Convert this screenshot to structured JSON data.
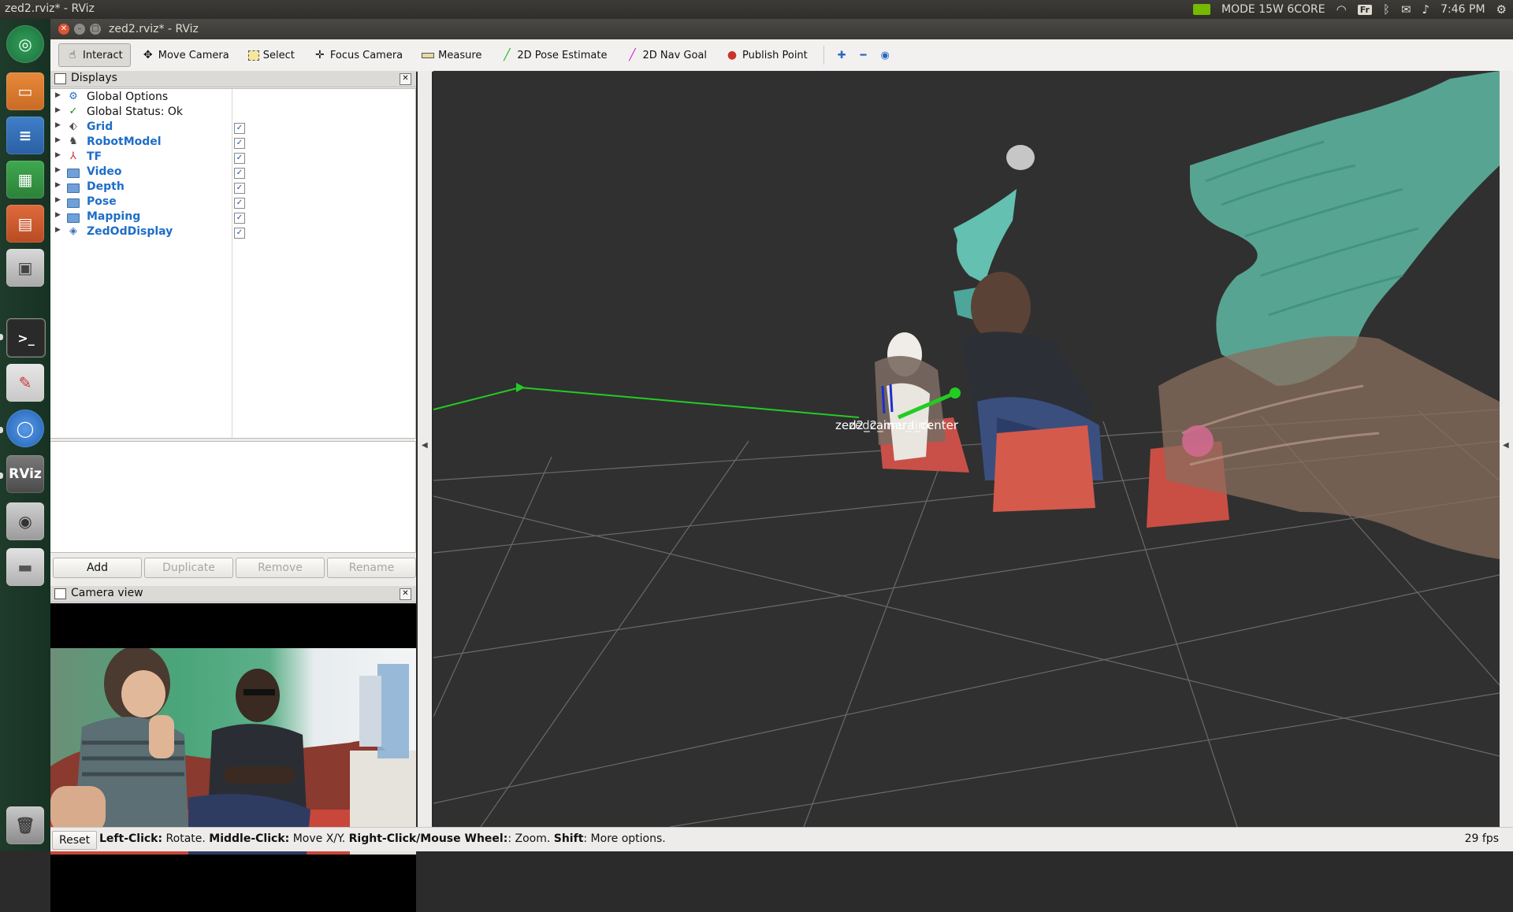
{
  "top_panel": {
    "window_title": "zed2.rviz* - RViz",
    "power_mode": "MODE 15W 6CORE",
    "keyboard_layout": "Fr",
    "clock": "7:46 PM",
    "icons": [
      "nvidia-icon",
      "wifi-icon",
      "keyboard-layout-icon",
      "bluetooth-icon",
      "mail-icon",
      "volume-icon",
      "clock",
      "gear-icon"
    ]
  },
  "launcher": {
    "items": [
      "ubuntu-dash",
      "files",
      "libreoffice-writer",
      "libreoffice-calc",
      "libreoffice-impress",
      "software-center",
      "terminal",
      "text-editor",
      "chromium",
      "rviz",
      "screenshot",
      "drive"
    ],
    "rviz_label": "RViz",
    "terminal_label": ">_"
  },
  "window": {
    "title": "zed2.rviz* - RViz"
  },
  "toolbar": {
    "tools": [
      {
        "label": "Interact",
        "icon": "interact-icon",
        "active": true
      },
      {
        "label": "Move Camera",
        "icon": "move-camera-icon",
        "active": false
      },
      {
        "label": "Select",
        "icon": "select-icon",
        "active": false
      },
      {
        "label": "Focus Camera",
        "icon": "focus-camera-icon",
        "active": false
      },
      {
        "label": "Measure",
        "icon": "measure-icon",
        "active": false
      },
      {
        "label": "2D Pose Estimate",
        "icon": "pose-estimate-icon",
        "active": false
      },
      {
        "label": "2D Nav Goal",
        "icon": "nav-goal-icon",
        "active": false
      },
      {
        "label": "Publish Point",
        "icon": "publish-point-icon",
        "active": false
      }
    ],
    "extra_icons": [
      "add-tool-icon",
      "remove-tool-icon",
      "camera-type-icon"
    ],
    "interact": "Interact",
    "move_camera": "Move Camera",
    "select": "Select",
    "focus_camera": "Focus Camera",
    "measure": "Measure",
    "pose_estimate": "2D Pose Estimate",
    "nav_goal": "2D Nav Goal",
    "publish_point": "Publish Point"
  },
  "displays_panel": {
    "title": "Displays",
    "rows": [
      {
        "label": "Global Options",
        "icon": "gear-icon",
        "checked": null
      },
      {
        "label": "Global Status: Ok",
        "icon": "check-icon",
        "checked": null
      },
      {
        "label": "Grid",
        "icon": "grid-icon",
        "checked": true
      },
      {
        "label": "RobotModel",
        "icon": "robot-model-icon",
        "checked": true
      },
      {
        "label": "TF",
        "icon": "tf-icon",
        "checked": true
      },
      {
        "label": "Video",
        "icon": "folder-icon",
        "checked": true
      },
      {
        "label": "Depth",
        "icon": "folder-icon",
        "checked": true
      },
      {
        "label": "Pose",
        "icon": "folder-icon",
        "checked": true
      },
      {
        "label": "Mapping",
        "icon": "folder-icon",
        "checked": true
      },
      {
        "label": "ZedOdDisplay",
        "icon": "object-detection-icon",
        "checked": true
      }
    ],
    "global_options": "Global Options",
    "global_status": "Global Status: Ok",
    "grid": "Grid",
    "robot_model": "RobotModel",
    "tf": "TF",
    "video": "Video",
    "depth": "Depth",
    "pose": "Pose",
    "mapping": "Mapping",
    "zed_od": "ZedOdDisplay",
    "checkmark": "✓",
    "buttons": {
      "add": "Add",
      "duplicate": "Duplicate",
      "remove": "Remove",
      "rename": "Rename"
    }
  },
  "camera_panel": {
    "title": "Camera view"
  },
  "viewport": {
    "frame_label": "zed2_camera_center",
    "frame_label_overlap": "zed2_imu_link"
  },
  "statusbar": {
    "reset": "Reset",
    "left_click": "Left-Click:",
    "left_click_action": " Rotate. ",
    "middle_click": "Middle-Click:",
    "middle_click_action": " Move X/Y. ",
    "right_click": "Right-Click/Mouse Wheel:",
    "right_click_action": ": Zoom. ",
    "shift": "Shift",
    "shift_action": ": More options.",
    "fps": "29 fps"
  },
  "colors": {
    "launcher_bg": "#1f3b2a",
    "viewport_bg": "#303030",
    "grid_line": "#6a6a6a",
    "odom_path": "#22cc22",
    "tree_label_blue": "#1e6ec8"
  }
}
